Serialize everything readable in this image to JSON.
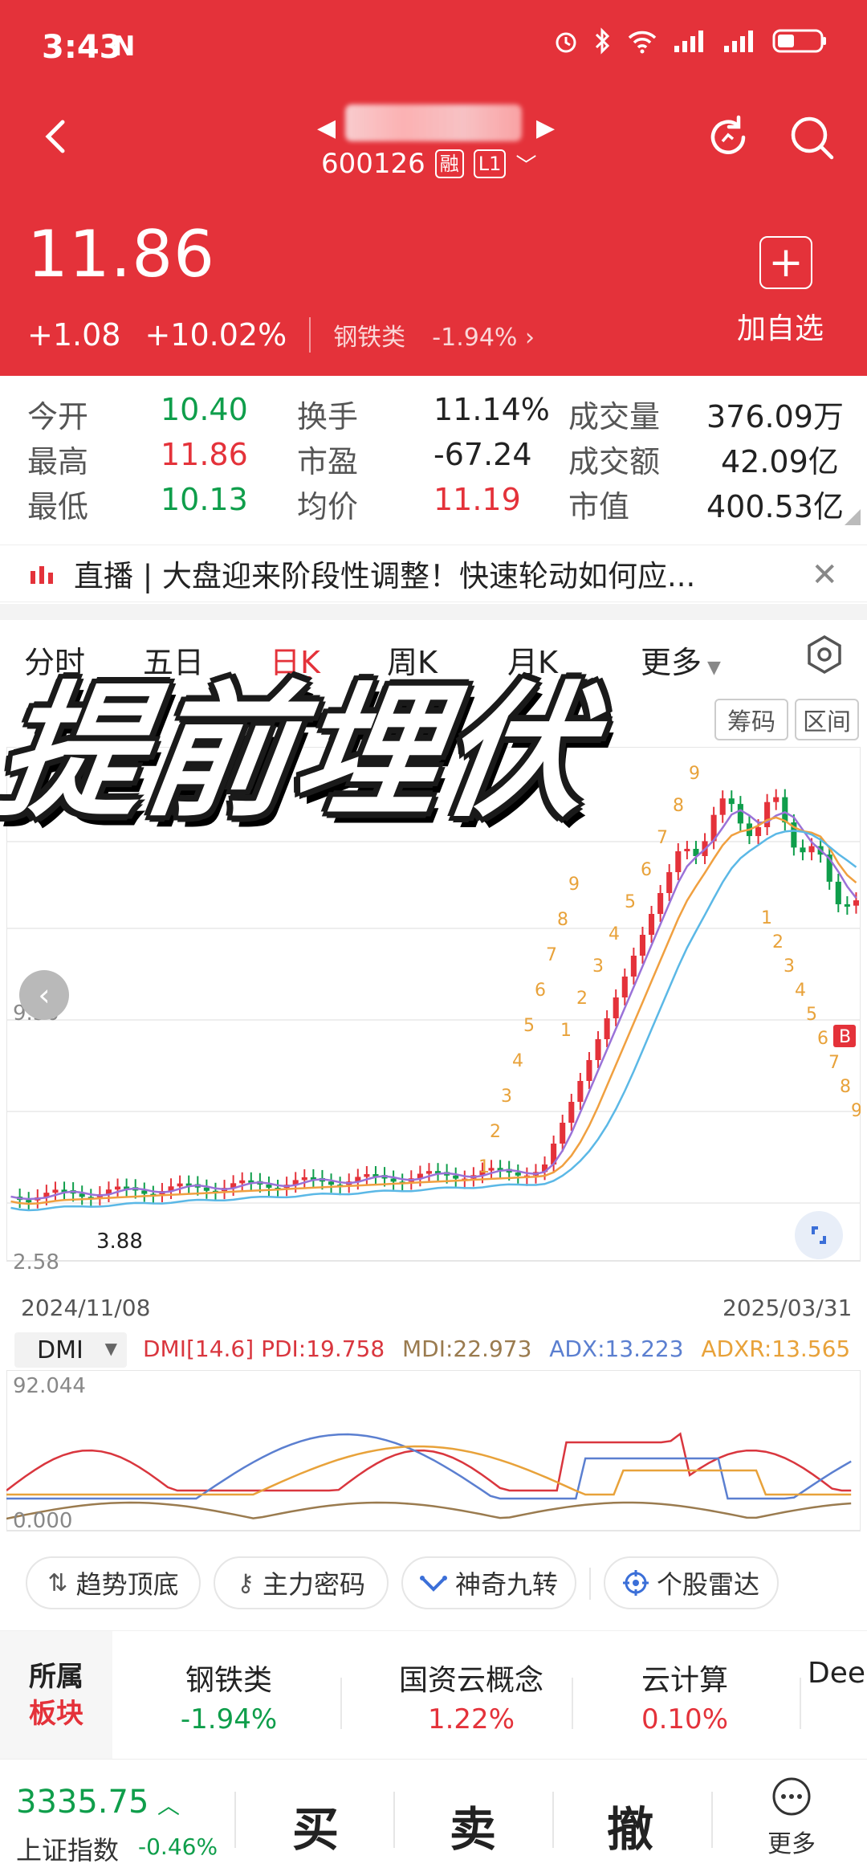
{
  "status": {
    "time": "3:43",
    "nfc": "N"
  },
  "stock": {
    "code": "600126",
    "tag_margin": "融",
    "tag_level": "L1",
    "price": "11.86",
    "change": "+1.08",
    "change_pct": "+10.02%",
    "sector": "钢铁类",
    "sector_pct": "-1.94%",
    "add_label": "加自选",
    "add_symbol": "+"
  },
  "quote": {
    "open_label": "今开",
    "open": "10.40",
    "high_label": "最高",
    "high": "11.86",
    "low_label": "最低",
    "low": "10.13",
    "turnover_label": "换手",
    "turnover": "11.14%",
    "pe_label": "市盈",
    "pe": "-67.24",
    "avg_label": "均价",
    "avg": "11.19",
    "volume_label": "成交量",
    "volume": "376.09万",
    "amount_label": "成交额",
    "amount": "42.09亿",
    "mcap_label": "市值",
    "mcap": "400.53亿"
  },
  "live": {
    "text": "直播 | 大盘迎来阶段性调整！快速轮动如何应..."
  },
  "tabs": [
    "分时",
    "五日",
    "日K",
    "周K",
    "月K",
    "更多"
  ],
  "chips": {
    "chips_label": "筹码",
    "range_label": "区间"
  },
  "overlay_title": "提前埋伏",
  "chart": {
    "axis_high": "9.30",
    "axis_low": "2.58",
    "low_mark": "3.88",
    "date_start": "2024/11/08",
    "date_end": "2025/03/31",
    "signal_b": "B",
    "count_labels": [
      "1",
      "2",
      "3",
      "4",
      "5",
      "6",
      "7",
      "8",
      "9",
      "1",
      "2",
      "3",
      "4",
      "5",
      "6",
      "7",
      "8",
      "9",
      "1",
      "2",
      "3",
      "4",
      "5",
      "6",
      "7",
      "8",
      "9"
    ]
  },
  "dmi": {
    "name": "DMI",
    "params": "DMI[14.6]",
    "pdi": "PDI:19.758",
    "mdi": "MDI:22.973",
    "adx": "ADX:13.223",
    "adxr": "ADXR:13.565",
    "axis_top": "92.044",
    "axis_bottom": "0.000",
    "colors": {
      "pdi": "#d9363e",
      "mdi": "#9a7b4f",
      "adx": "#5b7fd0",
      "adxr": "#e8a23a"
    }
  },
  "tools": [
    "趋势顶底",
    "主力密码",
    "神奇九转",
    "个股雷达"
  ],
  "sectors": {
    "label_top": "所属",
    "label_bottom": "板块",
    "items": [
      {
        "name": "钢铁类",
        "pct": "-1.94%"
      },
      {
        "name": "国资云概念",
        "pct": "1.22%"
      },
      {
        "name": "云计算",
        "pct": "0.10%"
      },
      {
        "name": "Dee",
        "pct": ""
      }
    ]
  },
  "bottom": {
    "index_value": "3335.75",
    "index_name": "上证指数",
    "index_pct": "-0.46%",
    "buy": "买",
    "sell": "卖",
    "cancel": "撤",
    "more": "更多"
  },
  "colors": {
    "brand_red": "#e4323a",
    "down_green": "#0f9e4b",
    "ma_blue": "#5bb8e6",
    "ma_orange": "#f0a040",
    "ma_purple": "#9a72d8"
  }
}
